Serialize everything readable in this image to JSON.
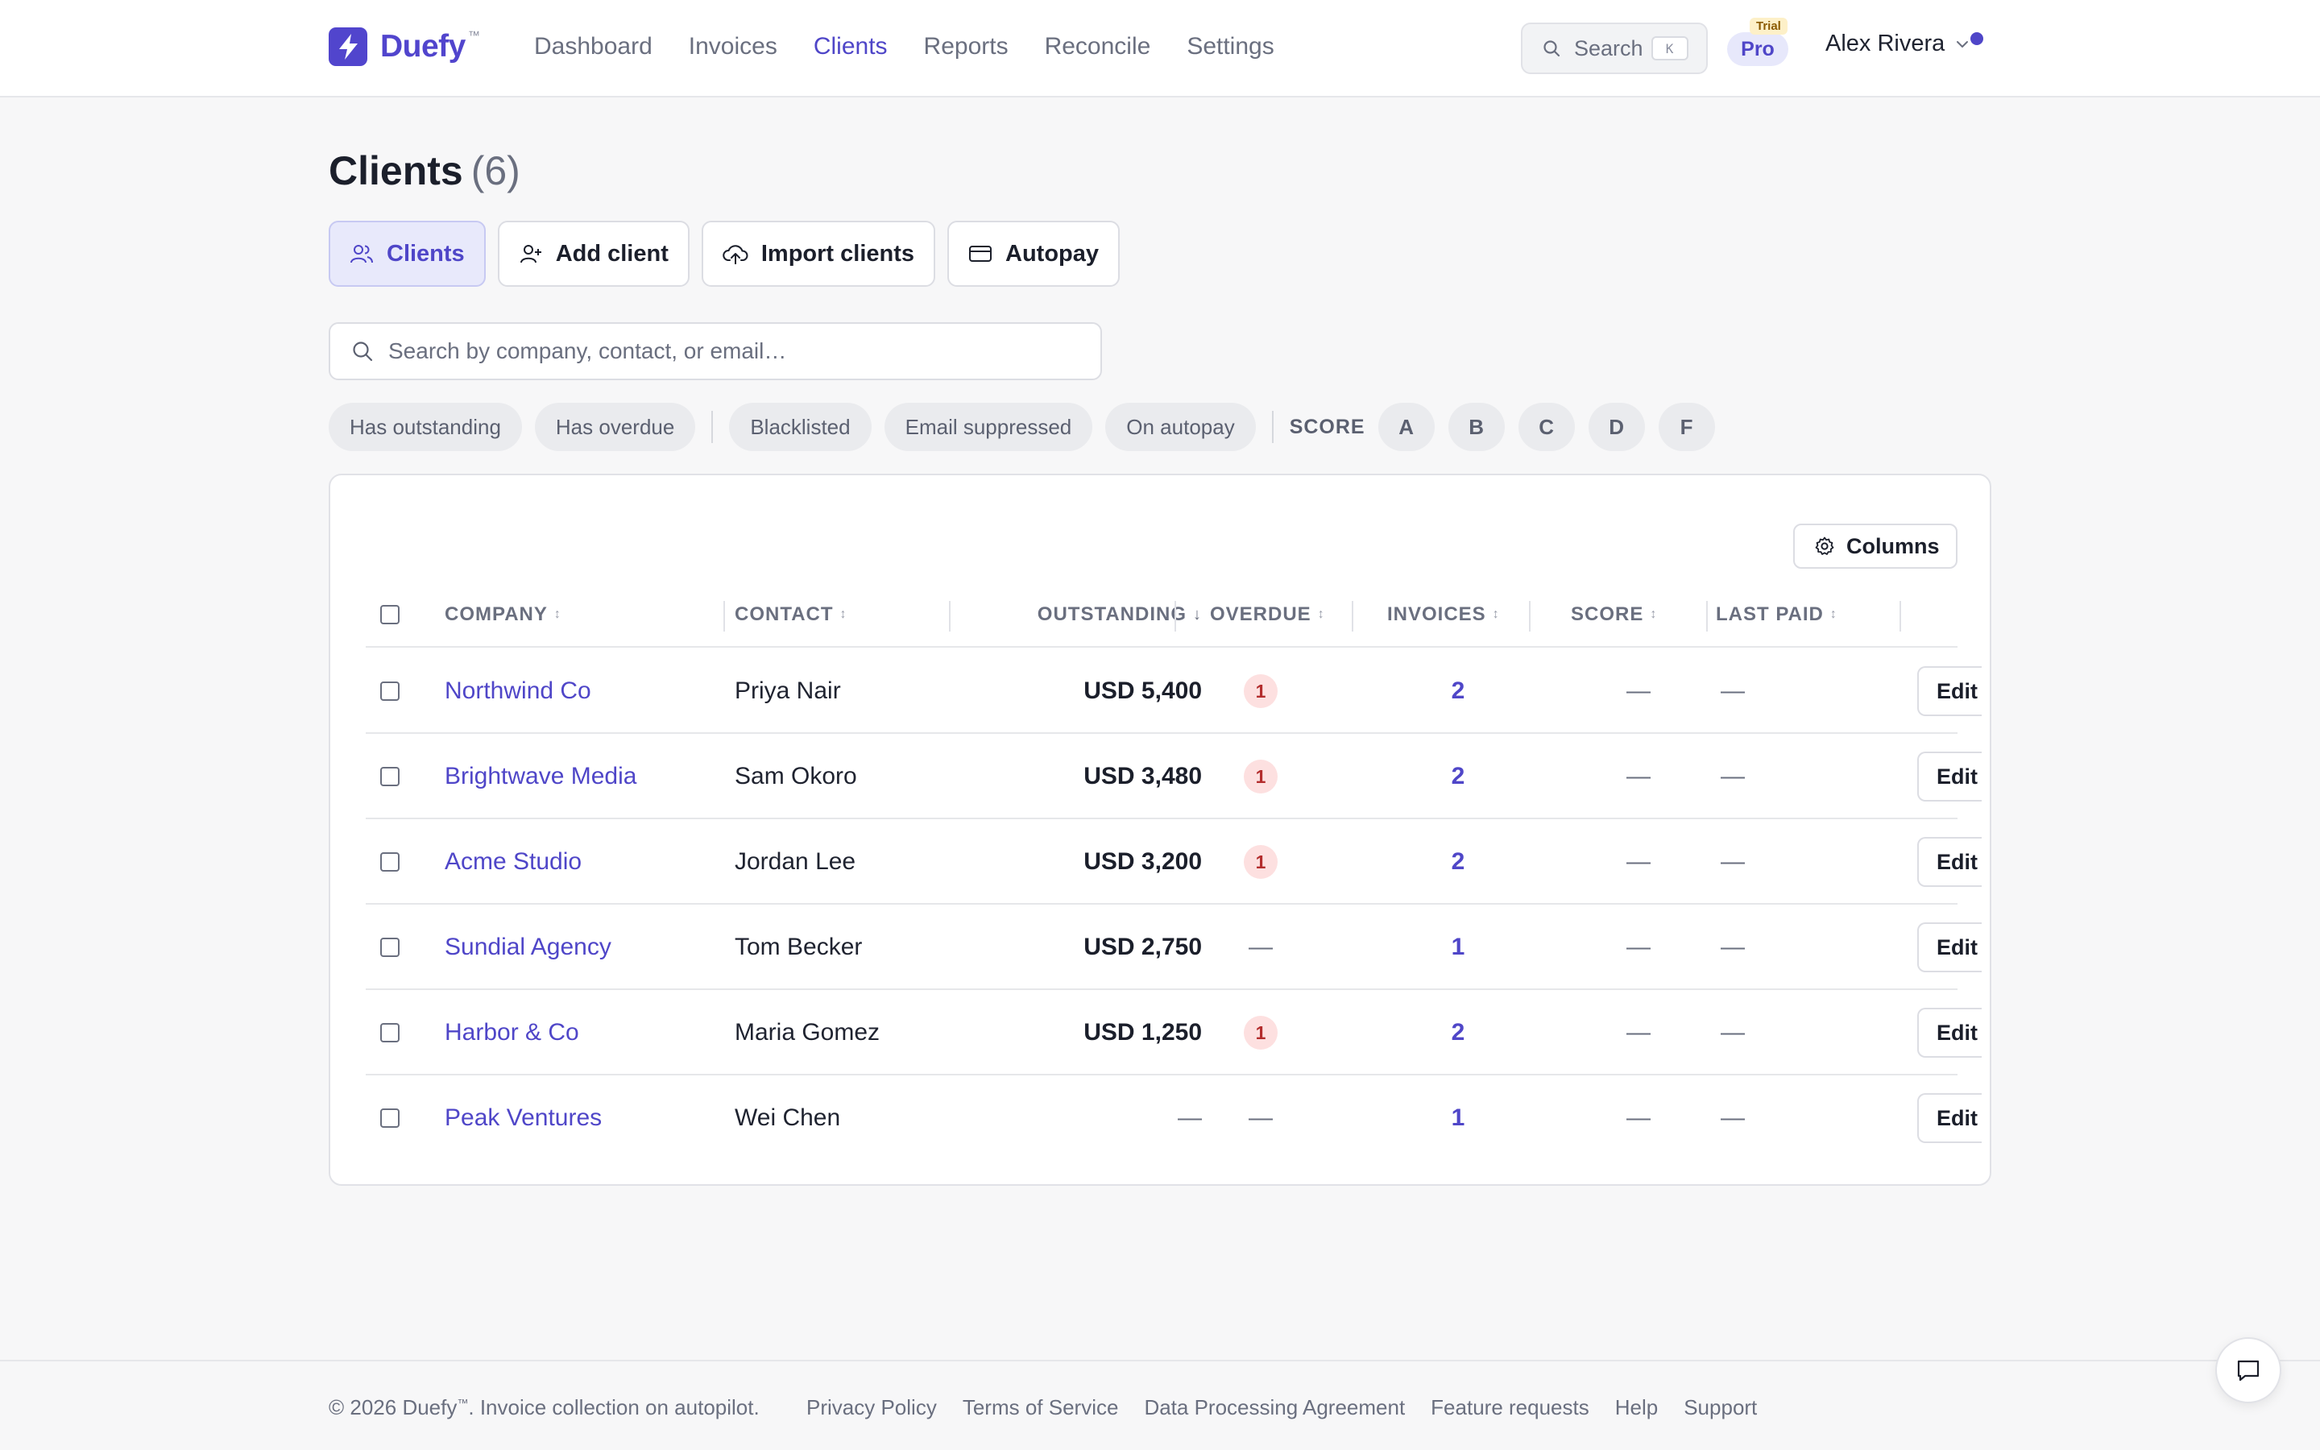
{
  "brand": {
    "name": "Duefy",
    "tm": "™"
  },
  "nav": [
    {
      "label": "Dashboard",
      "active": false
    },
    {
      "label": "Invoices",
      "active": false
    },
    {
      "label": "Clients",
      "active": true
    },
    {
      "label": "Reports",
      "active": false
    },
    {
      "label": "Reconcile",
      "active": false
    },
    {
      "label": "Settings",
      "active": false
    }
  ],
  "header": {
    "search_label": "Search",
    "search_kbd": "K",
    "plan": "Pro",
    "plan_tag": "Trial",
    "user_name": "Alex Rivera"
  },
  "page": {
    "title": "Clients",
    "count": "(6)"
  },
  "actions": {
    "clients": "Clients",
    "add_client": "Add client",
    "import_clients": "Import clients",
    "autopay": "Autopay"
  },
  "search": {
    "placeholder": "Search by company, contact, or email…",
    "value": ""
  },
  "filters": {
    "chips": [
      "Has outstanding",
      "Has overdue",
      "Blacklisted",
      "Email suppressed",
      "On autopay"
    ],
    "score_label": "SCORE",
    "scores": [
      "A",
      "B",
      "C",
      "D",
      "F"
    ]
  },
  "table": {
    "columns_button": "Columns",
    "headers": {
      "company": "COMPANY",
      "contact": "CONTACT",
      "outstanding": "OUTSTANDING",
      "overdue": "OVERDUE",
      "invoices": "INVOICES",
      "score": "SCORE",
      "last_paid": "LAST PAID"
    },
    "sort_column": "outstanding",
    "sort_direction": "desc",
    "edit_label": "Edit",
    "rows": [
      {
        "company": "Northwind Co",
        "contact": "Priya Nair",
        "outstanding": "USD 5,400",
        "overdue": "1",
        "invoices": "2",
        "score": "—",
        "last_paid": "—"
      },
      {
        "company": "Brightwave Media",
        "contact": "Sam Okoro",
        "outstanding": "USD 3,480",
        "overdue": "1",
        "invoices": "2",
        "score": "—",
        "last_paid": "—"
      },
      {
        "company": "Acme Studio",
        "contact": "Jordan Lee",
        "outstanding": "USD 3,200",
        "overdue": "1",
        "invoices": "2",
        "score": "—",
        "last_paid": "—"
      },
      {
        "company": "Sundial Agency",
        "contact": "Tom Becker",
        "outstanding": "USD 2,750",
        "overdue": "—",
        "invoices": "1",
        "score": "—",
        "last_paid": "—"
      },
      {
        "company": "Harbor & Co",
        "contact": "Maria Gomez",
        "outstanding": "USD 1,250",
        "overdue": "1",
        "invoices": "2",
        "score": "—",
        "last_paid": "—"
      },
      {
        "company": "Peak Ventures",
        "contact": "Wei Chen",
        "outstanding": "—",
        "overdue": "—",
        "invoices": "1",
        "score": "—",
        "last_paid": "—"
      }
    ]
  },
  "footer": {
    "copyright_prefix": "© 2026 Duefy",
    "tm": "™",
    "copyright_suffix": ". Invoice collection on autopilot.",
    "links": [
      "Privacy Policy",
      "Terms of Service",
      "Data Processing Agreement",
      "Feature requests",
      "Help",
      "Support"
    ]
  },
  "colors": {
    "accent": "#4f46c8",
    "brand_mark": "#5145cd",
    "overdue_badge_bg": "#fde0e0",
    "overdue_badge_text": "#b32d2d",
    "trial_tag_bg": "#fdf0c8"
  },
  "icons": {
    "brand": "bolt-icon",
    "search": "search-icon",
    "user_menu": "chevron-down-icon",
    "clients": "users-icon",
    "add_client": "user-plus-icon",
    "import": "cloud-upload-icon",
    "autopay": "credit-card-icon",
    "columns": "gear-icon",
    "chat": "chat-bubble-icon"
  }
}
